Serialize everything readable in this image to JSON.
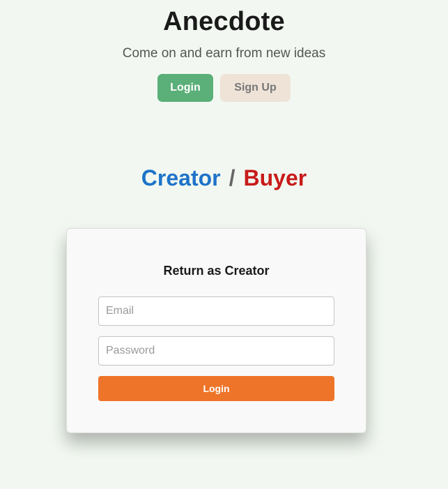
{
  "header": {
    "title": "Anecdote",
    "tagline": "Come on and earn from new ideas",
    "login_label": "Login",
    "signup_label": "Sign Up"
  },
  "role_switch": {
    "creator_label": "Creator",
    "separator": "/",
    "buyer_label": "Buyer"
  },
  "login_form": {
    "title": "Return as Creator",
    "email_placeholder": "Email",
    "email_value": "",
    "password_placeholder": "Password",
    "password_value": "",
    "submit_label": "Login"
  },
  "colors": {
    "background": "#f2f8f1",
    "login_button": "#5baf78",
    "signup_button": "#efe3d7",
    "creator": "#1e73c9",
    "buyer": "#c81b1b",
    "submit_button": "#ee7429"
  }
}
